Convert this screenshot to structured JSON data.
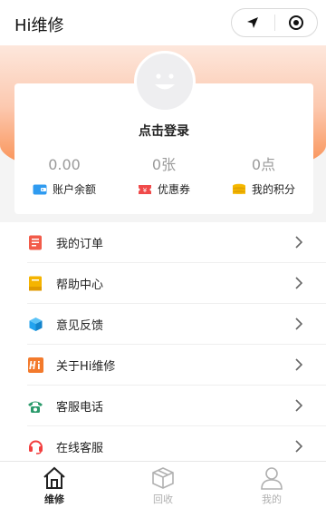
{
  "header": {
    "app_title": "Hi维修",
    "capsule": {
      "left_icon": "navigation-arrow-icon",
      "right_icon": "target-circle-icon"
    }
  },
  "profile": {
    "avatar_icon": "smiley-face-icon",
    "login_text": "点击登录",
    "stats": [
      {
        "value": "0.00",
        "label": "账户余额",
        "icon": "wallet-icon",
        "color": "#2f9bf0"
      },
      {
        "value": "0张",
        "label": "优惠券",
        "icon": "coupon-ticket-icon",
        "color": "#f04a4a"
      },
      {
        "value": "0点",
        "label": "我的积分",
        "icon": "coins-stack-icon",
        "color": "#f5b800"
      }
    ]
  },
  "menu": [
    {
      "label": "我的订单",
      "icon": "order-list-icon",
      "color": "#f25b4a"
    },
    {
      "label": "帮助中心",
      "icon": "help-book-icon",
      "color": "#f5b400"
    },
    {
      "label": "意见反馈",
      "icon": "feedback-cube-icon",
      "color": "#23a3ee"
    },
    {
      "label": "关于Hi维修",
      "icon": "hi-logo-icon",
      "color": "#f37a2c"
    },
    {
      "label": "客服电话",
      "icon": "phone-icon",
      "color": "#2a9a6b"
    },
    {
      "label": "在线客服",
      "icon": "headset-icon",
      "color": "#f23f3f"
    }
  ],
  "tabbar": [
    {
      "label": "维修",
      "icon": "home-icon",
      "active": true
    },
    {
      "label": "回收",
      "icon": "box-icon",
      "active": false
    },
    {
      "label": "我的",
      "icon": "user-icon",
      "active": false
    }
  ],
  "colors": {
    "accent": "#f9843f",
    "hero_top": "#fde7dc",
    "text_muted": "#9a9a9a"
  }
}
